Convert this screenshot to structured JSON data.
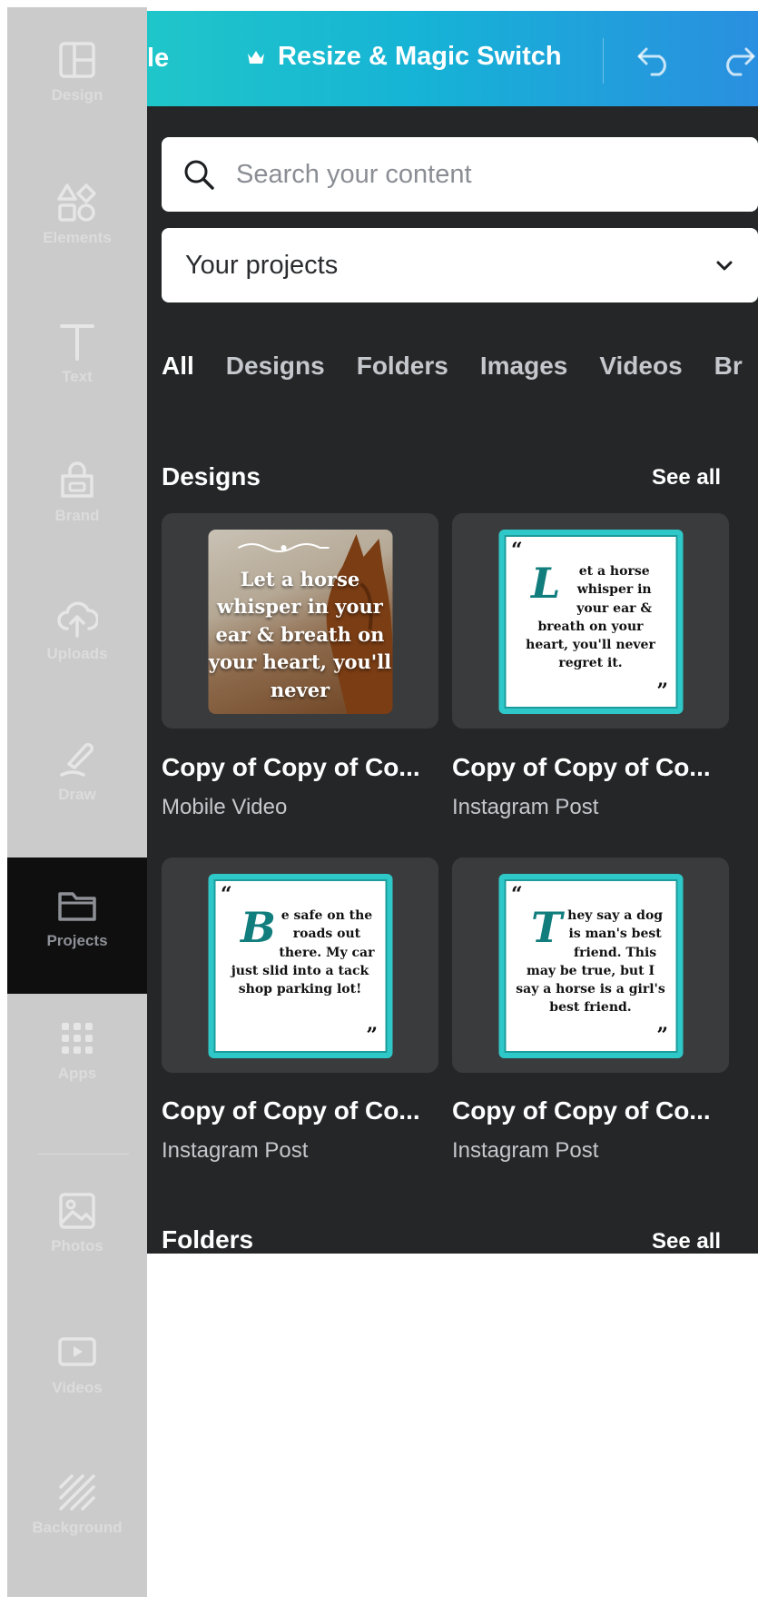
{
  "topbar": {
    "file_label": "le",
    "resize_label": "Resize & Magic Switch",
    "crown_icon": "crown-icon",
    "undo_icon": "undo-icon",
    "redo_icon": "redo-icon"
  },
  "search": {
    "placeholder": "Search your content",
    "icon": "search-icon"
  },
  "filter": {
    "selected": "Your projects",
    "icon": "chevron-down-icon"
  },
  "tabs": [
    "All",
    "Designs",
    "Folders",
    "Images",
    "Videos",
    "Br"
  ],
  "active_tab": "All",
  "designs_section": {
    "title": "Designs",
    "see_all": "See all",
    "items": [
      {
        "title": "Copy of Copy of Co...",
        "type": "Mobile Video",
        "thumb_text": "Let a horse whisper in your ear & breath on your heart, you'll never"
      },
      {
        "title": "Copy of Copy of Co...",
        "type": "Instagram Post",
        "thumb_initial": "L",
        "thumb_text": "et a horse whisper in your ear & breath on your heart, you'll never regret it."
      },
      {
        "title": "Copy of Copy of Co...",
        "type": "Instagram Post",
        "thumb_initial": "B",
        "thumb_text": "e safe on the roads out there. My car just slid into a tack shop parking lot!"
      },
      {
        "title": "Copy of Copy of Co...",
        "type": "Instagram Post",
        "thumb_initial": "T",
        "thumb_text": "hey say a dog is man's best friend. This may be true, but I say a horse is a girl's best friend."
      }
    ]
  },
  "folders_section": {
    "title": "Folders",
    "see_all": "See all"
  },
  "sidebar": {
    "items": [
      {
        "label": "Design",
        "icon": "design-icon"
      },
      {
        "label": "Elements",
        "icon": "elements-icon"
      },
      {
        "label": "Text",
        "icon": "text-icon"
      },
      {
        "label": "Brand",
        "icon": "brand-icon"
      },
      {
        "label": "Uploads",
        "icon": "uploads-icon"
      },
      {
        "label": "Draw",
        "icon": "draw-icon"
      },
      {
        "label": "Projects",
        "icon": "folder-icon"
      },
      {
        "label": "Apps",
        "icon": "apps-icon"
      },
      {
        "label": "Photos",
        "icon": "photos-icon"
      },
      {
        "label": "Videos",
        "icon": "videos-icon"
      },
      {
        "label": "Background",
        "icon": "background-icon"
      }
    ],
    "active": "Projects"
  },
  "colors": {
    "topbar_gradient_start": "#1fc6c9",
    "topbar_gradient_end": "#2a8fe0",
    "panel_bg": "#252627",
    "card_bg": "#3a3b3d",
    "tab_underline": "#8b5cf6",
    "quote_border": "#2ec8c8",
    "sidebar_bg": "#cbcbcc",
    "sidebar_active_bg": "#0f0f10"
  }
}
